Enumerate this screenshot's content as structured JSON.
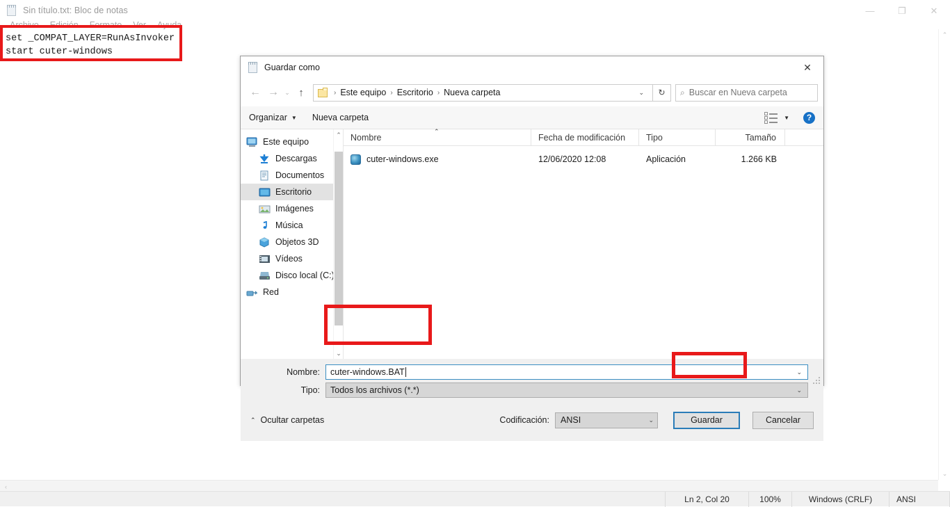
{
  "notepad": {
    "title": "Sin título.txt: Bloc de notas",
    "title_icon": "notepad-icon",
    "menu": [
      {
        "label": "Archivo"
      },
      {
        "label": "Edición"
      },
      {
        "label": "Formato"
      },
      {
        "label": "Ver"
      },
      {
        "label": "Ayuda"
      }
    ],
    "window_controls": {
      "minimize": "—",
      "maximize": "❐",
      "close": "✕"
    },
    "text_content": "set _COMPAT_LAYER=RunAsInvoker\nstart cuter-windows",
    "status": {
      "position": "Ln 2, Col 20",
      "zoom": "100%",
      "line_ending": "Windows (CRLF)",
      "encoding": "ANSI"
    }
  },
  "dialog": {
    "title": "Guardar como",
    "title_icon": "notepad-icon",
    "close_label": "✕",
    "nav": {
      "back": "←",
      "forward": "→",
      "recent": "⌄",
      "up": "↑",
      "folder_icon": "folder-icon",
      "breadcrumb": [
        "Este equipo",
        "Escritorio",
        "Nueva carpeta"
      ],
      "separator": "›",
      "dropdown": "⌄",
      "refresh": "↻"
    },
    "search": {
      "icon": "search-icon",
      "placeholder": "Buscar en Nueva carpeta",
      "value": ""
    },
    "toolbar": {
      "organize": "Organizar",
      "organize_caret": "▼",
      "new_folder": "Nueva carpeta",
      "view_icon": "list-view-icon",
      "view_caret": "▼",
      "help_icon": "help-icon",
      "help_glyph": "?"
    },
    "sidebar": {
      "items": [
        {
          "label": "Este equipo",
          "icon": "computer-icon",
          "indent": false,
          "selected": false
        },
        {
          "label": "Descargas",
          "icon": "downloads-icon",
          "indent": true,
          "selected": false
        },
        {
          "label": "Documentos",
          "icon": "documents-icon",
          "indent": true,
          "selected": false
        },
        {
          "label": "Escritorio",
          "icon": "desktop-icon",
          "indent": true,
          "selected": true
        },
        {
          "label": "Imágenes",
          "icon": "pictures-icon",
          "indent": true,
          "selected": false
        },
        {
          "label": "Música",
          "icon": "music-icon",
          "indent": true,
          "selected": false
        },
        {
          "label": "Objetos 3D",
          "icon": "objects3d-icon",
          "indent": true,
          "selected": false
        },
        {
          "label": "Vídeos",
          "icon": "videos-icon",
          "indent": true,
          "selected": false
        },
        {
          "label": "Disco local (C:)",
          "icon": "drive-icon",
          "indent": true,
          "selected": false
        },
        {
          "label": "Red",
          "icon": "network-icon",
          "indent": false,
          "selected": false
        }
      ],
      "scroll_up": "⌃",
      "scroll_down": "⌄"
    },
    "files": {
      "columns": [
        "Nombre",
        "Fecha de modificación",
        "Tipo",
        "Tamaño"
      ],
      "sort_indicator": "⌃",
      "rows": [
        {
          "name": "cuter-windows.exe",
          "icon": "exe-file-icon",
          "date": "12/06/2020 12:08",
          "type": "Aplicación",
          "size": "1.266 KB"
        }
      ]
    },
    "form": {
      "name_label": "Nombre:",
      "name_value": "cuter-windows.BAT",
      "name_dropdown": "⌄",
      "type_label": "Tipo:",
      "type_value": "Todos los archivos  (*.*)",
      "type_dropdown": "⌄"
    },
    "footer": {
      "hide_folders": "Ocultar carpetas",
      "hide_folders_caret": "⌃",
      "encoding_label": "Codificación:",
      "encoding_value": "ANSI",
      "encoding_dropdown": "⌄",
      "save_button": "Guardar",
      "cancel_button": "Cancelar"
    }
  },
  "annotations": {
    "color": "#e8191a",
    "boxes": [
      "code-text-highlight",
      "filename-field-highlight",
      "save-button-highlight"
    ]
  }
}
